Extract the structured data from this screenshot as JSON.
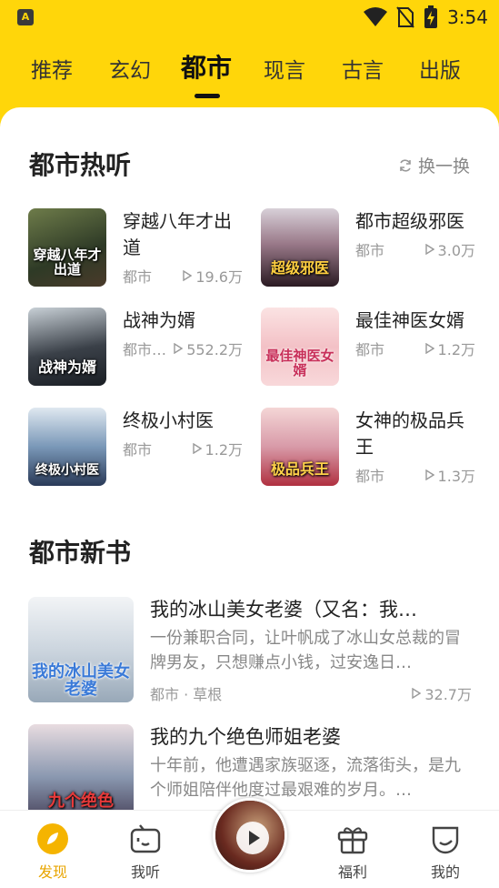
{
  "status_bar": {
    "app_icon_letter": "A",
    "time": "3:54"
  },
  "tabs": [
    {
      "label": "推荐"
    },
    {
      "label": "玄幻"
    },
    {
      "label": "都市"
    },
    {
      "label": "现言"
    },
    {
      "label": "古言"
    },
    {
      "label": "出版"
    }
  ],
  "active_tab": "都市",
  "hot_section": {
    "title": "都市热听",
    "swap_label": "换一换",
    "books": [
      {
        "title": "穿越八年才出道",
        "category": "都市",
        "plays": "19.6万",
        "cover_text": "穿越八年才出道",
        "cover_color": "#4a5a3a"
      },
      {
        "title": "都市超级邪医",
        "category": "都市",
        "plays": "3.0万",
        "cover_text": "超级邪医",
        "cover_color": "#3a2030"
      },
      {
        "title": "战神为婿",
        "category": "都市…",
        "plays": "552.2万",
        "cover_text": "战神为婿",
        "cover_color": "#2a2f38"
      },
      {
        "title": "最佳神医女婿",
        "category": "都市",
        "plays": "1.2万",
        "cover_text": "最佳神医女婿",
        "cover_color": "#f2c8c8"
      },
      {
        "title": "终极小村医",
        "category": "都市",
        "plays": "1.2万",
        "cover_text": "终极小村医",
        "cover_color": "#6c8aa8"
      },
      {
        "title": "女神的极品兵王",
        "category": "都市",
        "plays": "1.3万",
        "cover_text": "极品兵王",
        "cover_color": "#c98a8a"
      }
    ]
  },
  "new_section": {
    "title": "都市新书",
    "books": [
      {
        "title": "我的冰山美女老婆（又名：我…",
        "desc": "一份兼职合同，让叶帆成了冰山女总裁的冒牌男友，只想赚点小钱，过安逸日…",
        "meta_left": "都市 · 草根",
        "plays": "32.7万",
        "cover_text": "我的冰山美女老婆",
        "cover_color": "#dfe6ee"
      },
      {
        "title": "我的九个绝色师姐老婆",
        "desc": "十年前，他遭遇家族驱逐，流落街头，是九个师姐陪伴他度过最艰难的岁月。…",
        "meta_left": "",
        "plays": "",
        "cover_text": "九个绝色",
        "cover_color": "#9aa6b8"
      }
    ]
  },
  "bottom_nav": [
    {
      "label": "发现",
      "icon": "discover-icon",
      "active": true
    },
    {
      "label": "我听",
      "icon": "radio-tv-icon",
      "active": false
    },
    {
      "label": "福利",
      "icon": "gift-icon",
      "active": false
    },
    {
      "label": "我的",
      "icon": "profile-face-icon",
      "active": false
    }
  ],
  "player": {
    "icon": "play-icon"
  },
  "colors": {
    "brand_yellow": "#ffd60a",
    "active_nav": "#e8a500"
  }
}
